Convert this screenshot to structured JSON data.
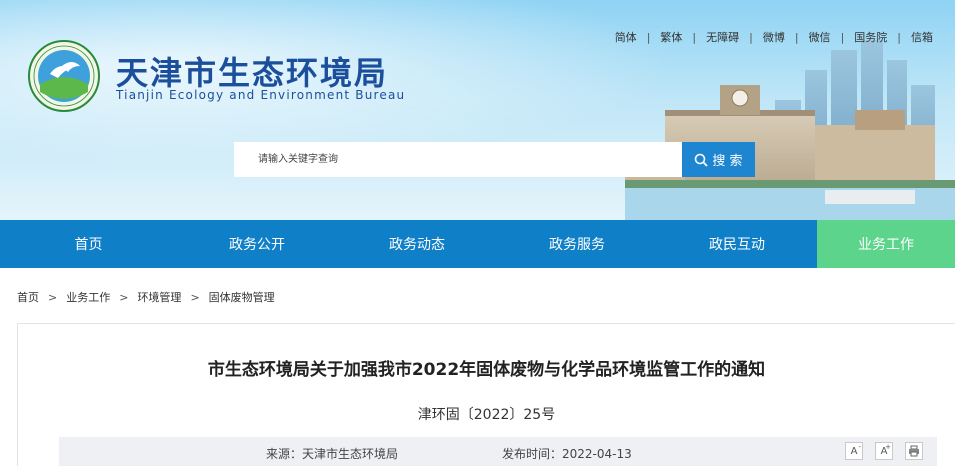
{
  "header": {
    "title_cn": "天津市生态环境局",
    "title_en": "Tianjin Ecology and Environment Bureau",
    "logo_text": "TIANJIN ECOLOGY ENVIRONMENT",
    "top_links": [
      "简体",
      "繁体",
      "无障碍",
      "微博",
      "微信",
      "国务院",
      "信箱"
    ],
    "top_link_separator": "|"
  },
  "search": {
    "placeholder": "请输入关键字查询",
    "button_label": "搜 索"
  },
  "nav": {
    "items": [
      "首页",
      "政务公开",
      "政务动态",
      "政务服务",
      "政民互动",
      "业务工作"
    ],
    "active_index": 5
  },
  "breadcrumb": {
    "items": [
      "首页",
      "业务工作",
      "环境管理",
      "固体废物管理"
    ],
    "separator": ">"
  },
  "article": {
    "title": "市生态环境局关于加强我市2022年固体废物与化学品环境监管工作的通知",
    "doc_number": "津环固〔2022〕25号",
    "source": "来源：天津市生态环境局",
    "publish_time": "发布时间：2022-04-13",
    "tools": {
      "font_decrease": "A",
      "font_decrease_sup": "-",
      "font_increase": "A",
      "font_increase_sup": "+",
      "print_icon": "print-icon"
    }
  },
  "colors": {
    "nav_bg": "#0f7fc8",
    "nav_active": "#5dd48c",
    "search_button": "#1e85d0",
    "title_blue": "#1b4f9c"
  }
}
